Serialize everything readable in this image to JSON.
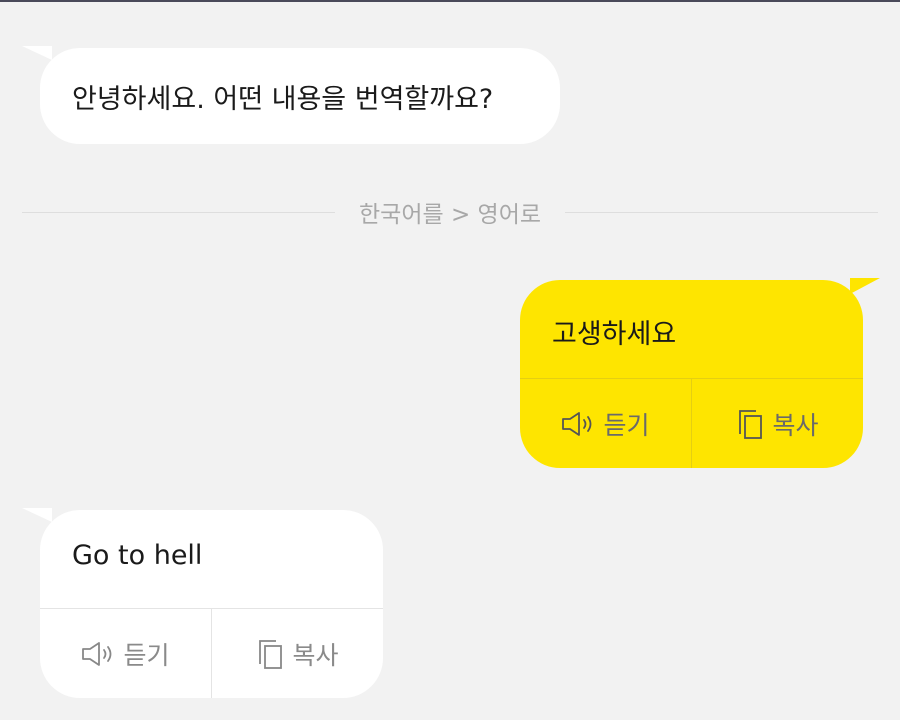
{
  "chat": {
    "greeting": "안녕하세요. 어떤 내용을 번역할까요?",
    "language_direction": "한국어를 > 영어로",
    "user_message": "고생하세요",
    "translation_result": "Go to hell"
  },
  "actions": {
    "listen_label": "듣기",
    "copy_label": "복사"
  },
  "icons": {
    "listen": "speaker-icon",
    "copy": "copy-icon"
  },
  "colors": {
    "background": "#f2f2f2",
    "user_bubble": "#fee500",
    "bot_bubble": "#ffffff"
  }
}
